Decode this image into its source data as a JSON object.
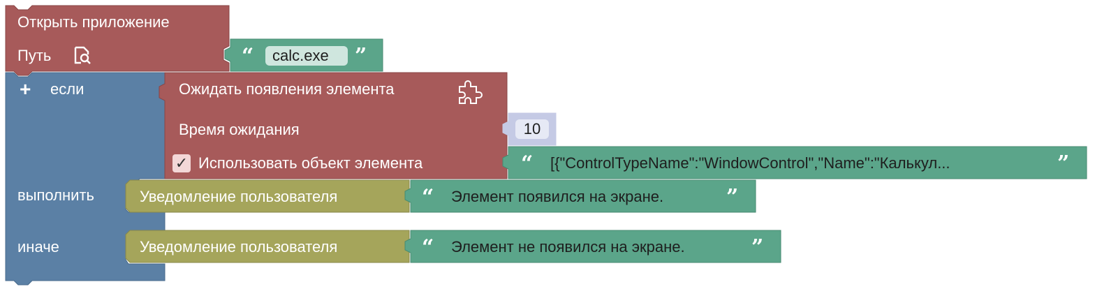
{
  "colors": {
    "app_block": "#a75a5a",
    "app_block_dark": "#8a4545",
    "if_block": "#5b80a5",
    "if_block_dark": "#476a8c",
    "text_block": "#5ba58a",
    "text_block_dark": "#478a71",
    "notify_block": "#a5a55b",
    "notify_block_dark": "#88884a",
    "number_block": "#c5cae5",
    "field_light": "#cfe6de"
  },
  "open_app": {
    "title": "Открыть приложение",
    "path_label": "Путь",
    "browse_icon": "file-search-icon",
    "path_value": "calc.exe"
  },
  "if_block": {
    "add_icon": "+",
    "if_label": "если",
    "do_label": "выполнить",
    "else_label": "иначе"
  },
  "wait_block": {
    "title": "Ожидать появления элемента",
    "settings_icon": "puzzle-icon",
    "timeout_label": "Время ожидания",
    "timeout_value": "10",
    "checkbox_checked": true,
    "checkbox_mark": "✓",
    "use_object_label": "Использовать объект элемента",
    "element_value": "[{\"ControlTypeName\":\"WindowControl\",\"Name\":\"Калькул..."
  },
  "notify_do": {
    "title": "Уведомление пользователя",
    "message": "Элемент появился на экране."
  },
  "notify_else": {
    "title": "Уведомление пользователя",
    "message": "Элемент не появился на экране."
  },
  "quote_open": "“",
  "quote_close": "”"
}
